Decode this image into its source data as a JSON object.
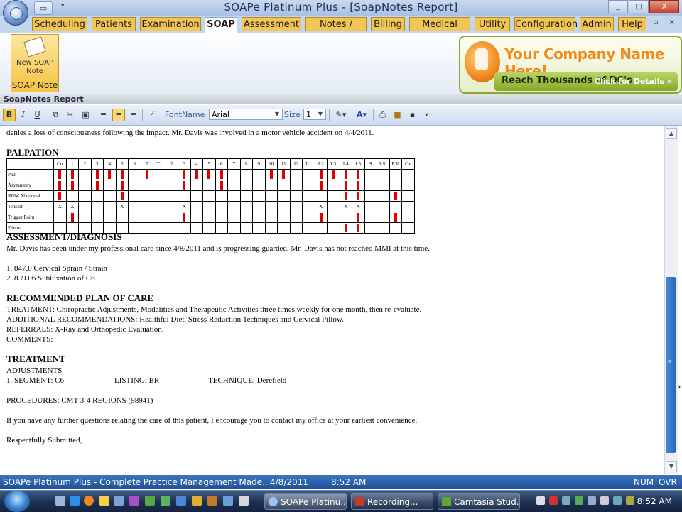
{
  "window": {
    "title": "SOAPe Platinum Plus - [SoapNotes Report]",
    "qat_icon": "folder-icon",
    "controls": [
      "_",
      "□",
      "X"
    ]
  },
  "tabs": [
    "Scheduling",
    "Patients",
    "Examination",
    "SOAP",
    "Assessment",
    "Notes / Lett...",
    "Billing",
    "Medical Rec...",
    "Utility",
    "Configuration",
    "Admin",
    "Help"
  ],
  "active_tab": "SOAP",
  "mini_controls": "- ▫ ×",
  "ribbon": {
    "button_label": "New SOAP Note",
    "group_label": "SOAP Note",
    "ad": {
      "title": "Your Company Name Here!",
      "subtitle": "Reach Thousands of DC's",
      "cta": "Click for Details »"
    }
  },
  "report_header": "SoapNotes Report",
  "toolbar": {
    "bold": "B",
    "italic": "I",
    "underline": "U",
    "fontname_label": "FontName",
    "font_value": "Arial",
    "size_label": "Size",
    "size_value": "1"
  },
  "document": {
    "intro": "denies a loss of consciousness following the impact. Mr. Davis was involved in a motor vehicle accident on 4/4/2011.",
    "palpation_heading": "PALPATION",
    "palpation": {
      "columns": [
        "Co",
        "1",
        "2",
        "3",
        "4",
        "5",
        "6",
        "7",
        "T1",
        "2",
        "3",
        "4",
        "5",
        "6",
        "7",
        "8",
        "9",
        "10",
        "11",
        "12",
        "L1",
        "L2",
        "L3",
        "L4",
        "L5",
        "S",
        "LSI",
        "RSI",
        "Cx"
      ],
      "rows": [
        {
          "label": "Pain",
          "cells": [
            "|",
            "|",
            "",
            "|",
            "|",
            "|",
            "",
            "|",
            "",
            "",
            "|",
            "|",
            "|",
            "|",
            "",
            "",
            "",
            "|",
            "|",
            "",
            "",
            "|",
            "|",
            "|",
            "|",
            "",
            "",
            "",
            ""
          ]
        },
        {
          "label": "Asymmetry",
          "cells": [
            "|",
            "|",
            "",
            "|",
            "",
            "|",
            "",
            "",
            "",
            "",
            "|",
            "",
            "",
            "|",
            "",
            "",
            "",
            "",
            "",
            "",
            "",
            "|",
            "",
            "|",
            "|",
            "",
            "",
            "",
            ""
          ]
        },
        {
          "label": "ROM Abnormal",
          "cells": [
            "|",
            "",
            "",
            "",
            "",
            "|",
            "",
            "",
            "",
            "",
            "",
            "",
            "",
            "",
            "",
            "",
            "",
            "",
            "",
            "",
            "",
            "",
            "",
            "|",
            "|",
            "",
            "",
            "|",
            ""
          ]
        },
        {
          "label": "Tension",
          "cells": [
            "X",
            "X",
            "",
            "",
            "",
            "X",
            "",
            "",
            "",
            "",
            "X",
            "",
            "",
            "",
            "",
            "",
            "",
            "",
            "",
            "",
            "",
            "X",
            "",
            "X",
            "X",
            "",
            "",
            "",
            ""
          ]
        },
        {
          "label": "Trigger Point",
          "cells": [
            "",
            "|",
            "",
            "",
            "",
            "",
            "",
            "",
            "",
            "",
            "|",
            "",
            "",
            "",
            "",
            "",
            "",
            "",
            "",
            "",
            "",
            "|",
            "",
            "",
            "|",
            "",
            "",
            "|",
            ""
          ]
        },
        {
          "label": "Edema",
          "cells": [
            "",
            "",
            "",
            "",
            "",
            "",
            "",
            "",
            "",
            "",
            "",
            "",
            "",
            "",
            "",
            "",
            "",
            "",
            "",
            "",
            "",
            "",
            "",
            "|",
            "|",
            "",
            "",
            "",
            ""
          ]
        }
      ]
    },
    "assessment_heading": "ASSESSMENT/DIAGNOSIS",
    "assessment_text": "Mr. Davis has been under my professional care since 4/8/2011 and is progressing guarded. Mr. Davis has not reached MMI at this time.",
    "diagnosis_1": "1. 847.0 Cervical Sprain / Strain",
    "diagnosis_2": "2. 839.06 Subluxation of C6",
    "plan_heading": "RECOMMENDED PLAN OF CARE",
    "plan_treatment": "TREATMENT: Chiropractic Adjustments, Modalities and Therapeutic Activities three times weekly for one month, then re-evaluate.",
    "plan_additional": "ADDITIONAL RECOMMENDATIONS: Healthful Diet, Stress Reduction Techniques and Cervical Pillow.",
    "plan_referrals": "REFERRALS: X-Ray and Orthopedic Evaluation.",
    "plan_comments": "COMMENTS:",
    "treatment_heading": "TREATMENT",
    "adjustments": "ADJUSTMENTS",
    "segment": "1. SEGMENT: C6",
    "listing": "LISTING: BR",
    "technique": "TECHNIQUE: Derefield",
    "procedures": "PROCEDURES: CMT 3-4 REGIONS (98941)",
    "closing": "If you have any further questions relating the care of this patient, I encourage you to contact my office at your earliest convenience.",
    "signoff": "Respectfully Submitted,"
  },
  "statusbar": {
    "app": "SOAPe Platinum Plus - Complete Practice Management Made...",
    "date": "4/8/2011",
    "time": "8:52 AM",
    "num": "NUM",
    "ovr": "OVR"
  },
  "taskbar": {
    "tasks": [
      "SOAPe Platinu...",
      "Recording...",
      "Camtasia Stud..."
    ],
    "clock": "8:52 AM"
  },
  "colors": {
    "tab_gold": "#f3c554",
    "status_blue": "#2d62ab",
    "palpation_mark": "#e00000"
  }
}
